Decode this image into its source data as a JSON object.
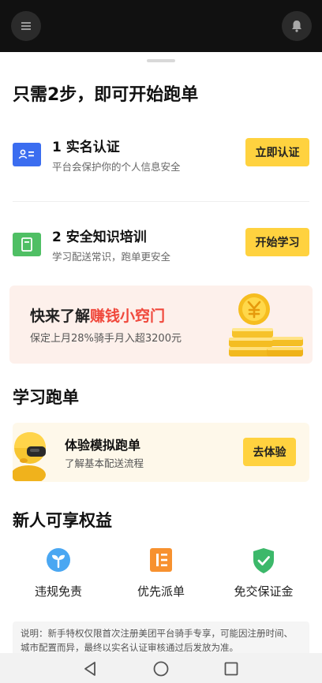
{
  "title": "只需2步，即可开始跑单",
  "steps": [
    {
      "title": "1 实名认证",
      "subtitle": "平台会保护你的个人信息安全",
      "button": "立即认证",
      "icon": "id-card-icon",
      "color": "#3b6df0"
    },
    {
      "title": "2 安全知识培训",
      "subtitle": "学习配送常识，跑单更安全",
      "button": "开始学习",
      "icon": "document-icon",
      "color": "#4fbf64"
    }
  ],
  "banner": {
    "title_prefix": "快来了解",
    "title_highlight": "赚钱小窍门",
    "subtitle": "保定上月28%骑手月入超3200元",
    "highlight_color": "#f0483c",
    "icon": "coins-icon"
  },
  "learn": {
    "heading": "学习跑单",
    "title": "体验模拟跑单",
    "subtitle": "了解基本配送流程",
    "button": "去体验",
    "icon": "rider-avatar-icon"
  },
  "perks": {
    "heading": "新人可享权益",
    "items": [
      {
        "label": "违规免责",
        "icon": "sprout-icon",
        "color": "#4aa7f2"
      },
      {
        "label": "优先派单",
        "icon": "priority-list-icon",
        "color": "#f7912f"
      },
      {
        "label": "免交保证金",
        "icon": "shield-check-icon",
        "color": "#3cb86a"
      }
    ]
  },
  "note": "说明：新手特权仅限首次注册美团平台骑手专享，可能因注册时间、城市配置而异，最终以实名认证审核通过后发放为准。",
  "colors": {
    "accent": "#ffd23f",
    "banner_bg": "#fdf0eb",
    "learn_bg": "#fef8ea"
  },
  "icons": {
    "menu": "menu-icon",
    "bell": "bell-icon",
    "back": "back-icon",
    "home": "home-icon",
    "recents": "recents-icon"
  }
}
